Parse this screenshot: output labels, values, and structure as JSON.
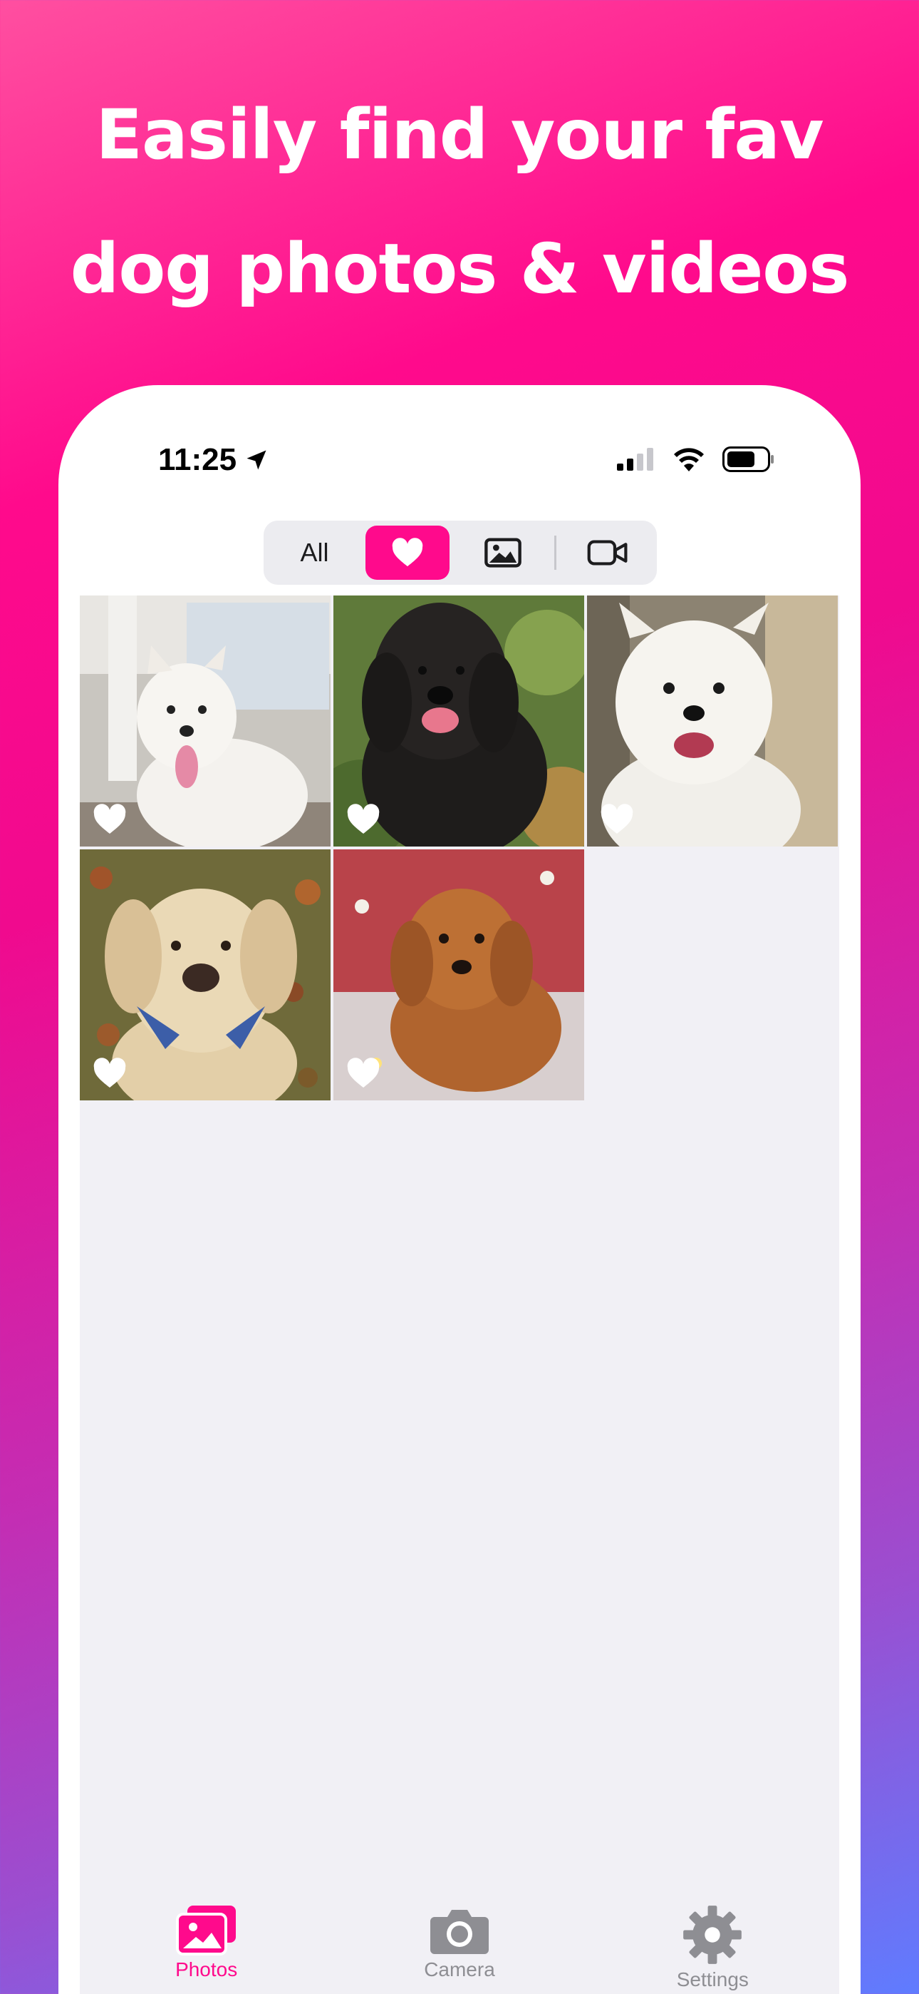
{
  "headline": {
    "line1": "Easily find your fav",
    "line2": "dog photos & videos"
  },
  "status_bar": {
    "time": "11:25",
    "icons": [
      "location-arrow-icon",
      "cellular-signal-icon",
      "wifi-icon",
      "battery-icon"
    ]
  },
  "filter": {
    "options": [
      {
        "label": "All",
        "selected": false
      },
      {
        "icon": "heart-icon",
        "selected": true
      },
      {
        "icon": "photo-icon",
        "selected": false
      },
      {
        "icon": "video-icon",
        "selected": false
      }
    ]
  },
  "photos": [
    {
      "favorite": true,
      "icon": "heart-icon"
    },
    {
      "favorite": true,
      "icon": "heart-icon"
    },
    {
      "favorite": true,
      "icon": "heart-icon"
    },
    {
      "favorite": true,
      "icon": "heart-icon"
    },
    {
      "favorite": true,
      "icon": "heart-icon"
    }
  ],
  "tabbar": {
    "items": [
      {
        "label": "Photos",
        "icon": "photos-icon",
        "active": true
      },
      {
        "label": "Camera",
        "icon": "camera-icon",
        "active": false
      },
      {
        "label": "Settings",
        "icon": "gear-icon",
        "active": false
      }
    ]
  },
  "colors": {
    "accent": "#ff0a8c",
    "inactive": "#8e8e93",
    "background": "#f1f0f5"
  }
}
